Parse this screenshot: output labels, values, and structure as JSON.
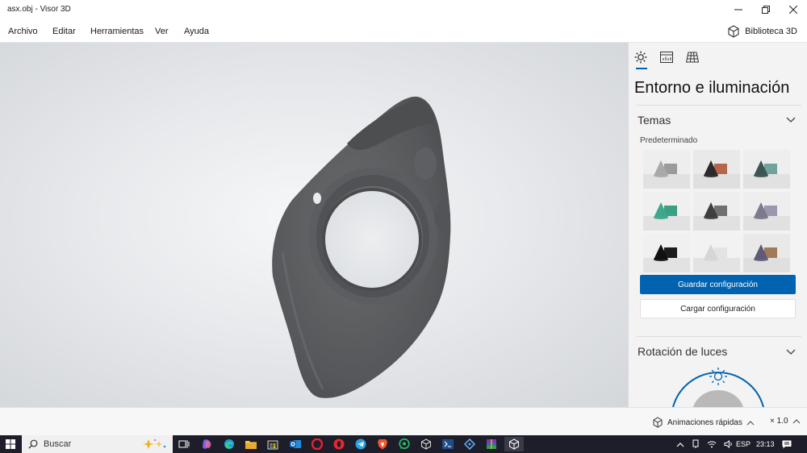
{
  "window": {
    "title": "asx.obj - Visor 3D",
    "controls": [
      "minimize-icon",
      "restore-icon",
      "close-icon"
    ]
  },
  "menu": {
    "items": [
      "Archivo",
      "Editar",
      "Herramientas",
      "Ver",
      "Ayuda"
    ],
    "library_label": "Biblioteca 3D"
  },
  "panel": {
    "tabs": [
      "sun-icon",
      "stats-icon",
      "grid-icon"
    ],
    "title": "Entorno e iluminación",
    "themes_section": "Temas",
    "themes_group": "Predeterminado",
    "themes": [
      {
        "name": "default-gray",
        "colors": [
          "#a9a9a9",
          "#9b9b9b"
        ],
        "bg": "#eeeeee",
        "selected": true
      },
      {
        "name": "copper-dark",
        "colors": [
          "#2a2a2a",
          "#b5664a"
        ],
        "bg": "#e9e9e9",
        "selected": false
      },
      {
        "name": "teal-dark",
        "colors": [
          "#3b5553",
          "#6fa39b"
        ],
        "bg": "#eeeeee",
        "selected": false
      },
      {
        "name": "green",
        "colors": [
          "#3ea88c",
          "#3a9f83"
        ],
        "bg": "#f0f0f0",
        "selected": false
      },
      {
        "name": "graphite",
        "colors": [
          "#3e3e3e",
          "#707070"
        ],
        "bg": "#eeeeee",
        "selected": false
      },
      {
        "name": "lavender",
        "colors": [
          "#7a7a8c",
          "#9a98ad"
        ],
        "bg": "#eeeeee",
        "selected": false
      },
      {
        "name": "black",
        "colors": [
          "#111111",
          "#1c1c1c"
        ],
        "bg": "#f0f0f0",
        "selected": false
      },
      {
        "name": "white",
        "colors": [
          "#d6d6d6",
          "#e3e3e3"
        ],
        "bg": "#f2f2f2",
        "selected": false
      },
      {
        "name": "purple-bronze",
        "colors": [
          "#5e5a78",
          "#a37a58"
        ],
        "bg": "#e9e9e9",
        "selected": false
      }
    ],
    "save_button": "Guardar configuración",
    "load_button": "Cargar configuración",
    "rotation_section": "Rotación de luces"
  },
  "status": {
    "animations_label": "Animaciones rápidas",
    "speed_label": "× 1.0"
  },
  "taskbar": {
    "search_placeholder": "Buscar",
    "language": "ESP",
    "time": "23:13"
  },
  "colors": {
    "accent": "#0063b1",
    "model": "#5a5b5d",
    "taskbar": "#1e1e2a"
  }
}
